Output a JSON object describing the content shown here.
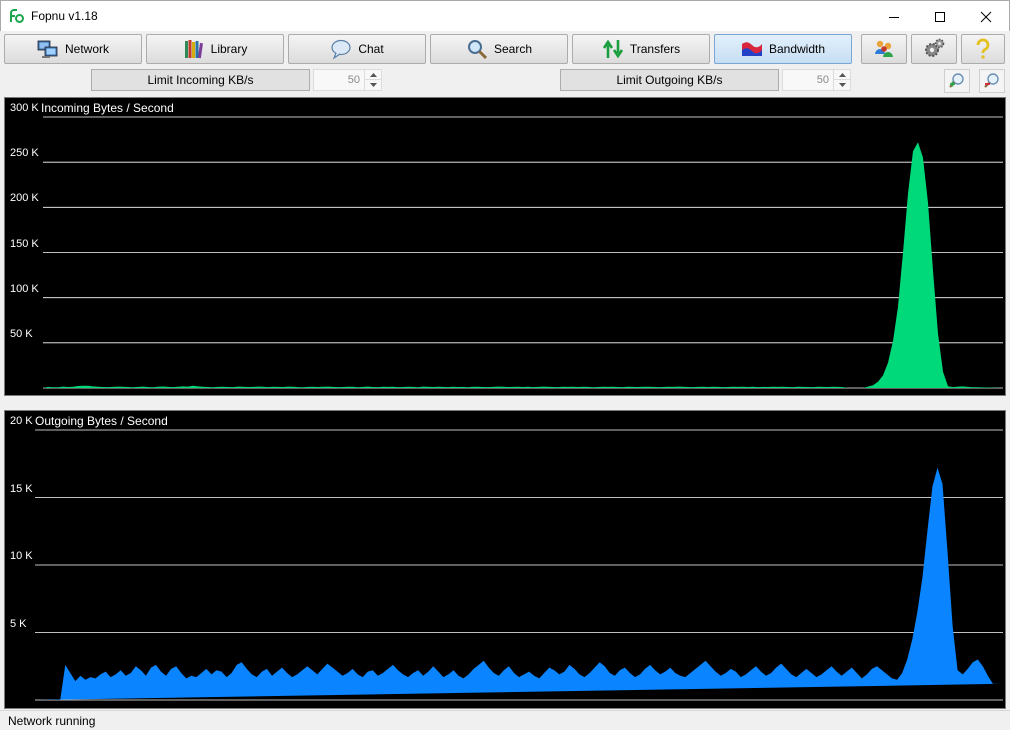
{
  "window": {
    "title": "Fopnu v1.18",
    "app_icon": "fopnu-logo-icon",
    "controls": [
      "minimize-icon",
      "maximize-icon",
      "close-icon"
    ]
  },
  "toolbar": {
    "buttons": [
      {
        "label": "Network",
        "icon": "network-computers-icon"
      },
      {
        "label": "Library",
        "icon": "books-icon"
      },
      {
        "label": "Chat",
        "icon": "speech-bubble-icon"
      },
      {
        "label": "Search",
        "icon": "magnifier-icon"
      },
      {
        "label": "Transfers",
        "icon": "up-down-arrows-icon"
      },
      {
        "label": "Bandwidth",
        "icon": "flag-graph-icon",
        "active": true
      }
    ],
    "icon_buttons": [
      "users-icon",
      "settings-gears-icon",
      "help-question-icon"
    ]
  },
  "limits": {
    "incoming_label": "Limit Incoming KB/s",
    "incoming_value": "50",
    "outgoing_label": "Limit Outgoing KB/s",
    "outgoing_value": "50",
    "zoom_in_icon": "zoom-in-icon",
    "zoom_out_icon": "zoom-out-icon"
  },
  "colors": {
    "incoming_series": "#00d97a",
    "outgoing_series": "#0a84ff",
    "graph_background": "#000000",
    "gridline": "#ffffff",
    "active_tab": "#c6def4"
  },
  "chart_data": [
    {
      "type": "area",
      "title": "Incoming Bytes / Second",
      "xlabel": "",
      "ylabel": "",
      "y_ticks": [
        "50 K",
        "100 K",
        "150 K",
        "200 K",
        "250 K",
        "300 K"
      ],
      "y_tick_values": [
        50000,
        100000,
        150000,
        200000,
        250000,
        300000
      ],
      "ylim": [
        0,
        300000
      ],
      "grid": true,
      "x": [
        0,
        1,
        2,
        3,
        4,
        5,
        6,
        7,
        8,
        9,
        10,
        11,
        12,
        13,
        14,
        15,
        16,
        17,
        18,
        19,
        20,
        21,
        22,
        23,
        24,
        25,
        26,
        27,
        28,
        29,
        30,
        31,
        32,
        33,
        34,
        35,
        36,
        37,
        38,
        39,
        40,
        41,
        42,
        43,
        44,
        45,
        46,
        47,
        48,
        49,
        50,
        51,
        52,
        53,
        54,
        55,
        56,
        57,
        58,
        59,
        60,
        61,
        62,
        63,
        64,
        65,
        66,
        67,
        68,
        69,
        70,
        71,
        72,
        73,
        74,
        75,
        76,
        77,
        78,
        79,
        80,
        81,
        82,
        83,
        84,
        85,
        86,
        87,
        88,
        89,
        90,
        91,
        92,
        93,
        94,
        95,
        96,
        97,
        98,
        99,
        100,
        101,
        102,
        103,
        104,
        105,
        106,
        107,
        108,
        109,
        110,
        111,
        112,
        113,
        114,
        115,
        116,
        117,
        118,
        119,
        120,
        121,
        122,
        123,
        124,
        125,
        126,
        127,
        128,
        129,
        130,
        131,
        132,
        133,
        134,
        135,
        136,
        137,
        138,
        139,
        140,
        141,
        142,
        143,
        144,
        145,
        146,
        147,
        148,
        149,
        150,
        151,
        152,
        153,
        154,
        155,
        156,
        157,
        158,
        159,
        160,
        161,
        162,
        163,
        164,
        165,
        166,
        167,
        168,
        169,
        170,
        171,
        172,
        173,
        174,
        175,
        176,
        177,
        178,
        179,
        180,
        181,
        182,
        183,
        184,
        185,
        186,
        187,
        188,
        189,
        190,
        191,
        192
      ],
      "series": [
        {
          "values": [
            0,
            1200,
            800,
            900,
            1500,
            1100,
            1300,
            2200,
            2600,
            2400,
            1800,
            1400,
            1100,
            1000,
            1200,
            1600,
            1300,
            1100,
            900,
            1200,
            1500,
            1100,
            900,
            1300,
            1700,
            1200,
            1000,
            1400,
            1800,
            1500,
            2400,
            1800,
            1300,
            1100,
            900,
            1200,
            1400,
            1100,
            1000,
            1500,
            1300,
            1100,
            1200,
            1600,
            1400,
            1000,
            1300,
            1200,
            1100,
            1500,
            1300,
            1000,
            900,
            1200,
            1400,
            1100,
            1300,
            1600,
            1200,
            1000,
            1100,
            1400,
            1300,
            900,
            1200,
            1500,
            1100,
            1000,
            1300,
            1200,
            1400,
            1000,
            1100,
            1300,
            1200,
            900,
            1500,
            1300,
            1100,
            1400,
            1200,
            1000,
            1300,
            1100,
            1200,
            900,
            1400,
            1300,
            1100,
            1000,
            1200,
            1500,
            1300,
            1100,
            1200,
            1400,
            1100,
            1300,
            1000,
            1200,
            1600,
            1400,
            1100,
            1000,
            1300,
            1200,
            1400,
            1100,
            1300,
            1200,
            900,
            1100,
            1300,
            1200,
            1400,
            1100,
            1000,
            1300,
            1200,
            1100,
            1400,
            1300,
            1200,
            1000,
            1100,
            1300,
            1200,
            1500,
            1300,
            1100,
            1000,
            1200,
            1300,
            1100,
            1400,
            1200,
            1000,
            1100,
            1300,
            1200,
            1400,
            1100,
            1300,
            1000,
            1200,
            1100,
            1300,
            1200,
            1400,
            1100,
            1000,
            1300,
            1200,
            1100,
            1000,
            1300,
            1200,
            1100,
            1400,
            1200,
            1000,
            0,
            0,
            0,
            0,
            1500,
            3000,
            7000,
            14000,
            28000,
            52000,
            90000,
            150000,
            215000,
            262000,
            272000,
            255000,
            205000,
            130000,
            60000,
            18000,
            2000,
            1000,
            1500,
            1800,
            1200,
            900,
            800
          ],
          "color": "#00d97a"
        }
      ]
    },
    {
      "type": "area",
      "title": "Outgoing Bytes / Second",
      "xlabel": "",
      "ylabel": "",
      "y_ticks": [
        "5 K",
        "10 K",
        "15 K",
        "20 K"
      ],
      "y_tick_values": [
        5000,
        10000,
        15000,
        20000
      ],
      "ylim": [
        0,
        20000
      ],
      "grid": true,
      "x": [
        0,
        1,
        2,
        3,
        4,
        5,
        6,
        7,
        8,
        9,
        10,
        11,
        12,
        13,
        14,
        15,
        16,
        17,
        18,
        19,
        20,
        21,
        22,
        23,
        24,
        25,
        26,
        27,
        28,
        29,
        30,
        31,
        32,
        33,
        34,
        35,
        36,
        37,
        38,
        39,
        40,
        41,
        42,
        43,
        44,
        45,
        46,
        47,
        48,
        49,
        50,
        51,
        52,
        53,
        54,
        55,
        56,
        57,
        58,
        59,
        60,
        61,
        62,
        63,
        64,
        65,
        66,
        67,
        68,
        69,
        70,
        71,
        72,
        73,
        74,
        75,
        76,
        77,
        78,
        79,
        80,
        81,
        82,
        83,
        84,
        85,
        86,
        87,
        88,
        89,
        90,
        91,
        92,
        93,
        94,
        95,
        96,
        97,
        98,
        99,
        100,
        101,
        102,
        103,
        104,
        105,
        106,
        107,
        108,
        109,
        110,
        111,
        112,
        113,
        114,
        115,
        116,
        117,
        118,
        119,
        120,
        121,
        122,
        123,
        124,
        125,
        126,
        127,
        128,
        129,
        130,
        131,
        132,
        133,
        134,
        135,
        136,
        137,
        138,
        139,
        140,
        141,
        142,
        143,
        144,
        145,
        146,
        147,
        148,
        149,
        150,
        151,
        152,
        153,
        154,
        155,
        156,
        157,
        158,
        159,
        160,
        161,
        162,
        163,
        164,
        165,
        166,
        167,
        168,
        169,
        170,
        171,
        172,
        173,
        174,
        175,
        176,
        177,
        178,
        179,
        180,
        181,
        182,
        183,
        184,
        185,
        186,
        187,
        188,
        189,
        190,
        191,
        192
      ],
      "series": [
        {
          "values": [
            0,
            0,
            0,
            0,
            0,
            0,
            2600,
            2000,
            1400,
            1800,
            1500,
            1700,
            1600,
            1900,
            2100,
            1700,
            1900,
            2200,
            1800,
            2000,
            2500,
            2200,
            1800,
            2400,
            2600,
            2100,
            1800,
            2300,
            2500,
            2000,
            1600,
            1800,
            1700,
            2000,
            2300,
            1900,
            2200,
            2100,
            1700,
            2000,
            2600,
            2800,
            2300,
            1900,
            1700,
            2100,
            2300,
            1800,
            2100,
            2400,
            2000,
            1700,
            1900,
            2200,
            2500,
            2200,
            1900,
            2300,
            2700,
            2400,
            2100,
            1800,
            2000,
            2300,
            1900,
            1700,
            2100,
            2200,
            1800,
            2000,
            2300,
            2600,
            2200,
            1900,
            1700,
            2000,
            2200,
            1800,
            2100,
            2500,
            2100,
            1700,
            1900,
            2200,
            1800,
            1600,
            1900,
            2300,
            2600,
            2900,
            2400,
            2000,
            1800,
            2200,
            2500,
            2000,
            1700,
            1900,
            2100,
            1800,
            1600,
            2000,
            2400,
            2200,
            1900,
            2100,
            2600,
            2300,
            1900,
            1700,
            2000,
            2400,
            2800,
            2500,
            2000,
            1800,
            2200,
            2400,
            2000,
            1700,
            1900,
            2300,
            2600,
            2200,
            1900,
            2100,
            2400,
            2000,
            1800,
            1700,
            2000,
            2300,
            2600,
            2900,
            2500,
            2100,
            1800,
            2000,
            2300,
            2100,
            1700,
            1900,
            2200,
            2500,
            2100,
            1800,
            2000,
            2400,
            2700,
            2300,
            1900,
            1700,
            2000,
            2300,
            2000,
            1700,
            1900,
            2200,
            2500,
            2100,
            1800,
            2100,
            2400,
            2000,
            1600,
            1900,
            2300,
            2500,
            2200,
            1900,
            1600,
            1500,
            2000,
            3000,
            4500,
            6500,
            9000,
            12500,
            15800,
            17200,
            16000,
            11000,
            5500,
            2200,
            1900,
            2300,
            2800,
            3000,
            2500,
            1800,
            1200,
            1200,
            1200,
            1200
          ],
          "color": "#0a84ff"
        }
      ]
    }
  ],
  "status": {
    "text": "Network running"
  }
}
